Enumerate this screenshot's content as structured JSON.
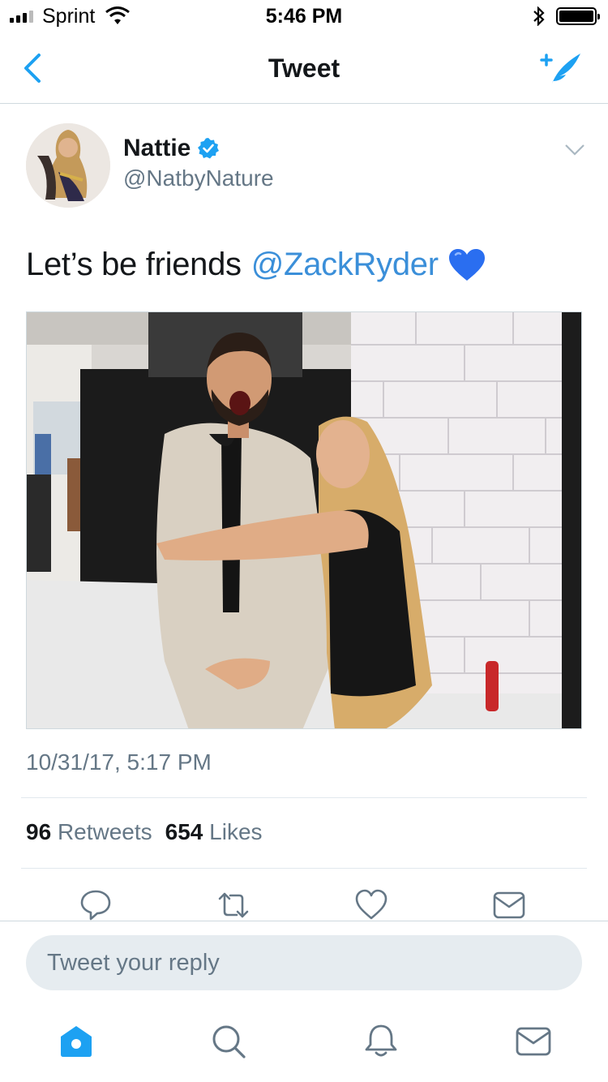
{
  "status_bar": {
    "carrier": "Sprint",
    "time": "5:46 PM",
    "battery_level": 1.0
  },
  "nav": {
    "title": "Tweet",
    "back_icon": "chevron-left-icon",
    "compose_icon": "compose-tweet-icon"
  },
  "tweet": {
    "author": {
      "display_name": "Nattie",
      "handle": "@NatbyNature",
      "verified": true
    },
    "text": "Let’s be friends",
    "mention": "@ZackRyder",
    "emoji": "blue-heart",
    "timestamp": "10/31/17, 5:17 PM",
    "stats": {
      "retweets_count": "96",
      "retweets_label": "Retweets",
      "likes_count": "654",
      "likes_label": "Likes"
    }
  },
  "actions": [
    "reply-icon",
    "retweet-icon",
    "like-icon",
    "direct-message-icon"
  ],
  "reply": {
    "placeholder": "Tweet your reply"
  },
  "tabbar": [
    "home-icon",
    "search-icon",
    "notifications-icon",
    "messages-icon"
  ],
  "colors": {
    "accent": "#1da1f2",
    "mention": "#3b8fd9",
    "secondary_text": "#657786",
    "divider": "#e1e8ed"
  }
}
